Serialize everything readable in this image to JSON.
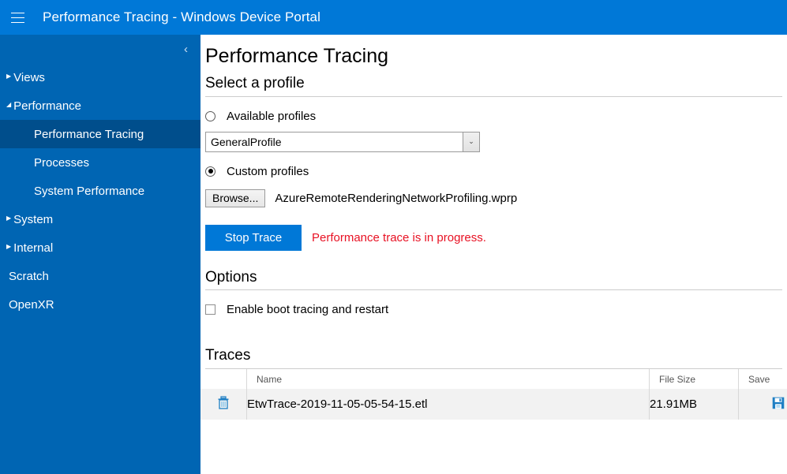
{
  "titlebar": {
    "menu_icon": "hamburger-menu-icon",
    "title": "Performance Tracing - Windows Device Portal",
    "background": "#0078D7"
  },
  "sidebar": {
    "background": "#0065B3",
    "selected_background": "#004E8C",
    "collapse_icon": "‹",
    "items": [
      {
        "label": "Views",
        "arrow": "▶",
        "level": 0,
        "selected": false
      },
      {
        "label": "Performance",
        "arrow": "◢",
        "level": 0,
        "selected": false
      },
      {
        "label": "Performance Tracing",
        "arrow": "",
        "level": 1,
        "selected": true
      },
      {
        "label": "Processes",
        "arrow": "",
        "level": 1,
        "selected": false
      },
      {
        "label": "System Performance",
        "arrow": "",
        "level": 1,
        "selected": false
      },
      {
        "label": "System",
        "arrow": "▶",
        "level": 0,
        "selected": false
      },
      {
        "label": "Internal",
        "arrow": "▶",
        "level": 0,
        "selected": false
      },
      {
        "label": "Scratch",
        "arrow": "",
        "level": 0,
        "selected": false
      },
      {
        "label": "OpenXR",
        "arrow": "",
        "level": 0,
        "selected": false
      }
    ]
  },
  "main": {
    "page_title": "Performance Tracing",
    "profile_section": {
      "heading": "Select a profile",
      "available_radio_label": "Available profiles",
      "available_radio_checked": false,
      "selected_profile": "GeneralProfile",
      "dropdown_arrow": "⌄",
      "custom_radio_label": "Custom profiles",
      "custom_radio_checked": true,
      "browse_label": "Browse...",
      "custom_filename": "AzureRemoteRenderingNetworkProfiling.wprp",
      "stop_button_label": "Stop Trace",
      "stop_button_color": "#0078D7",
      "status_message": "Performance trace is in progress.",
      "status_color": "#E81123"
    },
    "options_section": {
      "heading": "Options",
      "boot_tracing_label": "Enable boot tracing and restart",
      "boot_tracing_checked": false
    },
    "traces_section": {
      "heading": "Traces",
      "columns": {
        "delete": "",
        "name": "Name",
        "file_size": "File Size",
        "save": "Save"
      },
      "rows": [
        {
          "delete_icon": "trash-icon",
          "name": "EtwTrace-2019-11-05-05-54-15.etl",
          "file_size": "21.91MB",
          "save_icon": "floppy-save-icon"
        }
      ],
      "icon_color": "#1E7FC4"
    }
  }
}
